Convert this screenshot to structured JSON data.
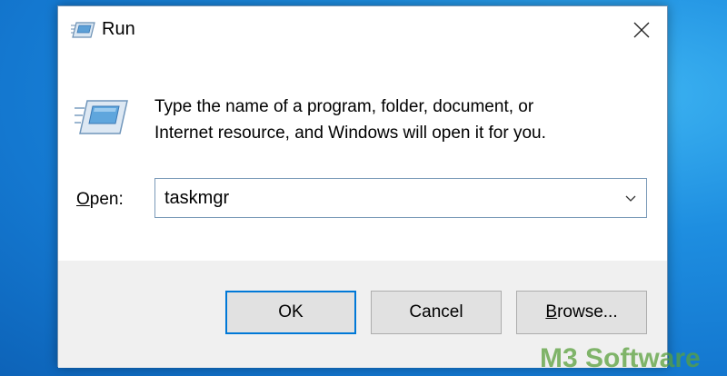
{
  "window": {
    "title": "Run",
    "close_icon": "close-icon",
    "app_icon": "run-icon"
  },
  "body": {
    "description_line1": "Type the name of a program, folder, document, or",
    "description_line2": "Internet resource, and Windows will open it for you.",
    "open_label_accel": "O",
    "open_label_rest": "pen:",
    "open_value": "taskmgr"
  },
  "buttons": {
    "ok": "OK",
    "cancel": "Cancel",
    "browse_accel": "B",
    "browse_rest": "rowse..."
  },
  "watermark": "M3 Software",
  "colors": {
    "accent": "#0078d7",
    "desktop": "#1e8ee0"
  }
}
